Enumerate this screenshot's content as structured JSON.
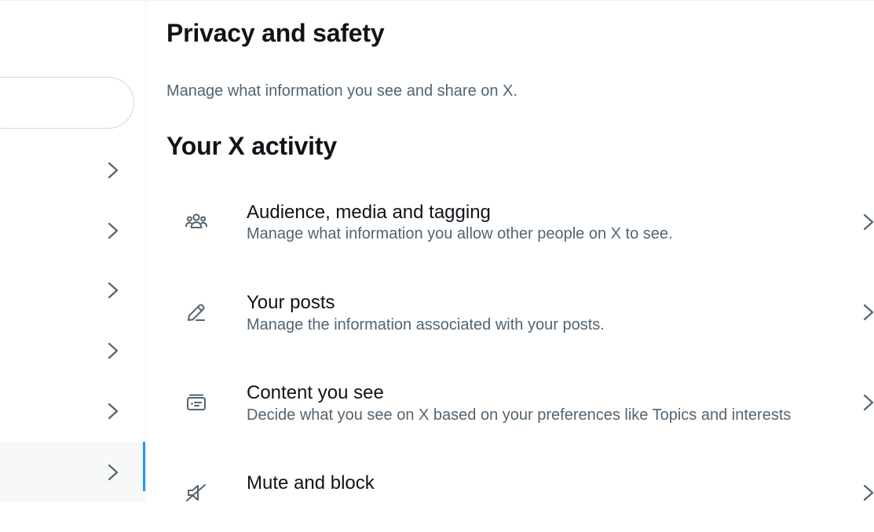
{
  "header": {
    "title": "Privacy and safety",
    "description": "Manage what information you see and share on X."
  },
  "section": {
    "title": "Your X activity"
  },
  "items": [
    {
      "label": "Audience, media and tagging",
      "description": "Manage what information you allow other people on X to see.",
      "icon": "people-icon"
    },
    {
      "label": "Your posts",
      "description": "Manage the information associated with your posts.",
      "icon": "pencil-icon"
    },
    {
      "label": "Content you see",
      "description": "Decide what you see on X based on your preferences like Topics and interests",
      "icon": "content-card-icon"
    },
    {
      "label": "Mute and block",
      "description": "",
      "icon": "mute-speaker-icon"
    }
  ],
  "nav": {
    "search_value": "",
    "item_count": 6,
    "active_index": 5
  },
  "colors": {
    "accent": "#1d9bf0",
    "text_primary": "#0f1419",
    "text_secondary": "#536471",
    "border": "#cfd9de",
    "active_bg": "#f7f9f9"
  }
}
